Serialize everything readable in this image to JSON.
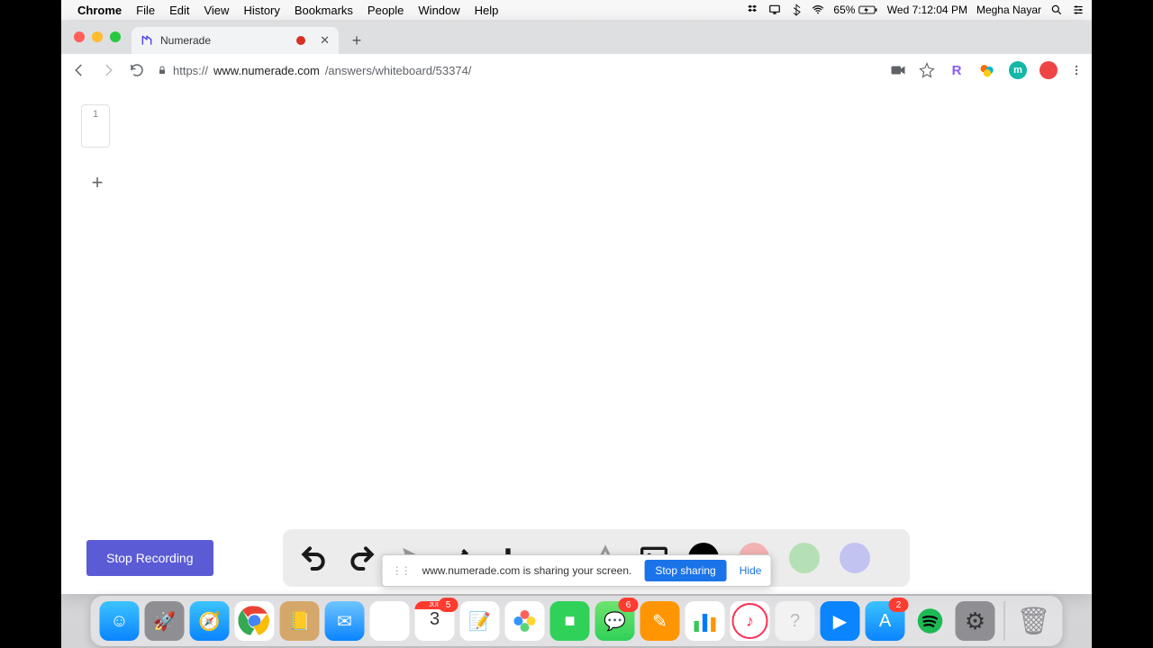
{
  "menubar": {
    "app": "Chrome",
    "menus": [
      "File",
      "Edit",
      "View",
      "History",
      "Bookmarks",
      "People",
      "Window",
      "Help"
    ],
    "battery": "65%",
    "datetime": "Wed 7:12:04 PM",
    "user": "Megha Nayar"
  },
  "browser": {
    "tab_title": "Numerade",
    "url_scheme": "https://",
    "url_host": "www.numerade.com",
    "url_path": "/answers/whiteboard/53374/",
    "extensions": [
      {
        "name": "R",
        "bg": "#8b5cf6"
      },
      {
        "name": "honey",
        "bg": "#ff8a00"
      },
      {
        "name": "m",
        "bg": "#14b8a6"
      },
      {
        "name": "●",
        "bg": "#ef4444"
      }
    ]
  },
  "whiteboard": {
    "slide_number": "1",
    "stop_recording": "Stop Recording",
    "colors": {
      "black": "#000000",
      "pink": "#f4b3b3",
      "green": "#b5e0b5",
      "purple": "#c3c3f2"
    }
  },
  "sharebar": {
    "text": "www.numerade.com is sharing your screen.",
    "stop": "Stop sharing",
    "hide": "Hide"
  },
  "dock": {
    "apps": [
      {
        "name": "finder",
        "bg": "linear-gradient(#3cc3ff,#0a84ff)"
      },
      {
        "name": "launchpad",
        "bg": "#8e8e93"
      },
      {
        "name": "safari",
        "bg": "linear-gradient(#3cc3ff,#0a84ff)"
      },
      {
        "name": "chrome",
        "bg": "#fff"
      },
      {
        "name": "contacts",
        "bg": "#d6a76a"
      },
      {
        "name": "mail",
        "bg": "linear-gradient(#6fc5ff,#0a84ff)"
      },
      {
        "name": "reminders",
        "bg": "#fff"
      },
      {
        "name": "calendar",
        "bg": "#fff",
        "badge": "5",
        "text": "3"
      },
      {
        "name": "notes",
        "bg": "#fff"
      },
      {
        "name": "photos",
        "bg": "#fff"
      },
      {
        "name": "facetime",
        "bg": "#30d158"
      },
      {
        "name": "messages",
        "bg": "linear-gradient(#6fe36f,#30d158)",
        "badge": "6"
      },
      {
        "name": "pages",
        "bg": "#ff9500"
      },
      {
        "name": "numbers",
        "bg": "#fff"
      },
      {
        "name": "itunes",
        "bg": "#fff"
      },
      {
        "name": "unknown",
        "bg": "#f2f2f2"
      },
      {
        "name": "keynote",
        "bg": "#0a84ff"
      },
      {
        "name": "appstore",
        "bg": "linear-gradient(#3cc3ff,#0a84ff)",
        "badge": "2"
      },
      {
        "name": "spotify",
        "bg": "#1db954"
      },
      {
        "name": "settings",
        "bg": "#8e8e93"
      }
    ],
    "trash": {
      "name": "trash",
      "bg": "#d0d0d0"
    }
  }
}
